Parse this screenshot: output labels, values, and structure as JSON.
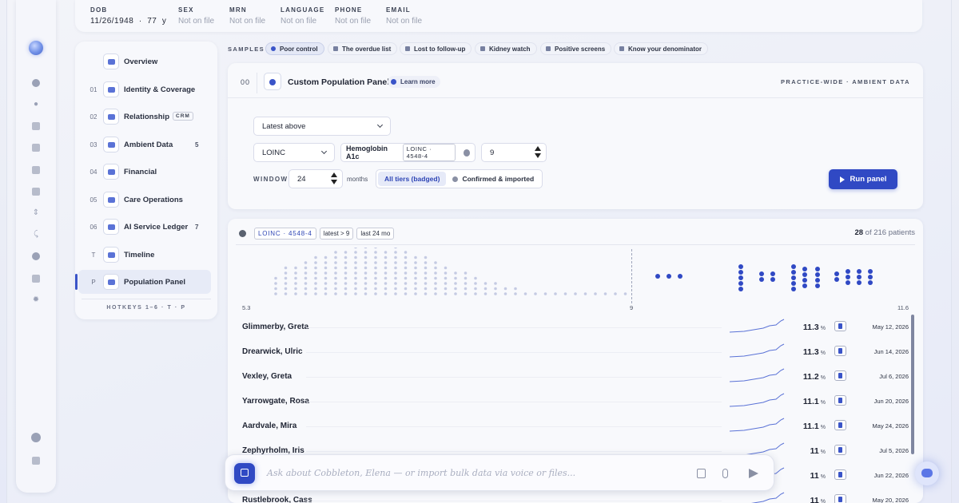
{
  "header": {
    "dob_label": "DOB",
    "dob_value": "11/26/1948  ·  77  y",
    "fields": [
      {
        "label": "SEX",
        "value": "Not on file"
      },
      {
        "label": "MRN",
        "value": "Not on file"
      },
      {
        "label": "LANGUAGE",
        "value": "Not on file"
      },
      {
        "label": "PHONE",
        "value": "Not on file"
      },
      {
        "label": "EMAIL",
        "value": "Not on file"
      }
    ]
  },
  "nav": {
    "items": [
      {
        "num": "",
        "label": "Overview",
        "badge": ""
      },
      {
        "num": "01",
        "label": "Identity & Coverage",
        "badge": ""
      },
      {
        "num": "02",
        "label": "Relationship",
        "badge": "",
        "tag": "CRM"
      },
      {
        "num": "03",
        "label": "Ambient Data",
        "badge": "5"
      },
      {
        "num": "04",
        "label": "Financial",
        "badge": ""
      },
      {
        "num": "05",
        "label": "Care Operations",
        "badge": ""
      },
      {
        "num": "06",
        "label": "AI Service Ledger",
        "badge": "7"
      },
      {
        "num": "T",
        "label": "Timeline",
        "badge": ""
      },
      {
        "num": "P",
        "label": "Population Panel",
        "badge": ""
      }
    ],
    "hotkeys": "HOTKEYS 1–6 · T · P"
  },
  "samples": {
    "label": "SAMPLES",
    "chips": [
      "Poor control",
      "The overdue list",
      "Lost to follow-up",
      "Kidney watch",
      "Positive screens",
      "Know your denominator"
    ]
  },
  "panel": {
    "number": "00",
    "title": "Custom Population Panel",
    "learn_more": "Learn more",
    "scope": "PRACTICE-WIDE · AMBIENT DATA",
    "mode_select": "Latest above",
    "code_system": "LOINC",
    "concept": "Hemoglobin A1c",
    "concept_code": "LOINC · 4548-4",
    "threshold": "9",
    "window_label": "WINDOW",
    "window_value": "24",
    "window_unit": "months",
    "tiers": [
      "All tiers (badged)",
      "Confirmed & imported"
    ],
    "run_label": "Run panel"
  },
  "results": {
    "tags": [
      "LOINC · 4548-4",
      "latest > 9",
      "last 24 mo"
    ],
    "count": "28",
    "count_suffix": " of 216 patients",
    "axis_min": "5.3",
    "axis_threshold": "9",
    "axis_max": "11.6",
    "unit": "%",
    "rows": [
      {
        "name": "Glimmerby, Greta",
        "value": "11.3",
        "date": "May 12, 2026"
      },
      {
        "name": "Drearwick, Ulric",
        "value": "11.3",
        "date": "Jun 14, 2026"
      },
      {
        "name": "Vexley, Greta",
        "value": "11.2",
        "date": "Jul 6, 2026"
      },
      {
        "name": "Yarrowgate, Rosa",
        "value": "11.1",
        "date": "Jun 20, 2026"
      },
      {
        "name": "Aardvale, Mira",
        "value": "11.1",
        "date": "May 24, 2026"
      },
      {
        "name": "Zephyrholm, Iris",
        "value": "11",
        "date": "Jul 5, 2026"
      },
      {
        "name": "",
        "value": "11",
        "date": "Jun 22, 2026"
      },
      {
        "name": "Rustlebrook, Cass",
        "value": "11",
        "date": "May 20, 2026"
      }
    ]
  },
  "ask": {
    "placeholder": "Ask about Cobbleton, Elena — or import bulk data via voice or files..."
  }
}
